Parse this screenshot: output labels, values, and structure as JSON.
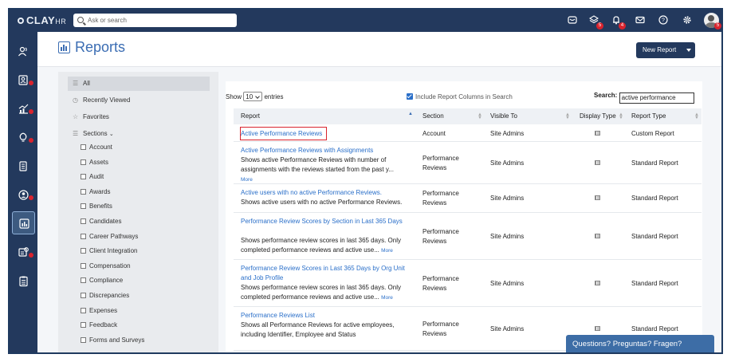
{
  "app": {
    "logo": "CLAY",
    "logo_suffix": "HR"
  },
  "search": {
    "placeholder": "Ask or search"
  },
  "topbar": {
    "badges": {
      "layers": "5",
      "bell": "4",
      "avatar": "5"
    }
  },
  "page": {
    "title": "Reports",
    "new_report_label": "New Report"
  },
  "sidebar": {
    "all": "All",
    "recently_viewed": "Recently Viewed",
    "favorites": "Favorites",
    "sections_label": "Sections",
    "sections": [
      "Account",
      "Assets",
      "Audit",
      "Awards",
      "Benefits",
      "Candidates",
      "Career Pathways",
      "Client Integration",
      "Compensation",
      "Compliance",
      "Discrepancies",
      "Expenses",
      "Feedback",
      "Forms and Surveys"
    ]
  },
  "table_controls": {
    "show_label": "Show",
    "entries_value": "10",
    "entries_label": "entries",
    "include_columns_label": "Include Report Columns in Search",
    "search_label": "Search:",
    "search_value": "active performance"
  },
  "table": {
    "headers": [
      "Report",
      "Section",
      "Visible To",
      "Display Type",
      "Report Type"
    ],
    "rows": [
      {
        "title": "Active Performance Reviews",
        "desc": "",
        "more": "",
        "section": "Account",
        "visible": "Site Admins",
        "type": "Custom Report"
      },
      {
        "title": "Active Performance Reviews with Assignments",
        "desc": "Shows active Performance Reviews with number of assignments with the reviews started from the past y...",
        "more": "More",
        "section": "Performance Reviews",
        "visible": "Site Admins",
        "type": "Standard Report"
      },
      {
        "title": "Active users with no active Performance Reviews.",
        "desc": "Shows active users with no active Performance Reviews.",
        "more": "",
        "section": "Performance Reviews",
        "visible": "Site Admins",
        "type": "Standard Report"
      },
      {
        "title": "Performance Review Scores by Section in Last 365 Days",
        "desc": "Shows performance review scores in last 365 days. Only completed performance reviews and active use...",
        "more": "More",
        "section": "Performance Reviews",
        "visible": "Site Admins",
        "type": "Standard Report"
      },
      {
        "title": "Performance Review Scores in Last 365 Days by Org Unit and Job Profile",
        "desc": "Shows performance review scores in last 365 days. Only completed performance reviews and active use...",
        "more": "More",
        "section": "Performance Reviews",
        "visible": "Site Admins",
        "type": "Standard Report"
      },
      {
        "title": "Performance Reviews List",
        "desc": "Shows all Performance Reviews for active employees, including Identifier, Employee and Status",
        "more": "",
        "section": "Performance Reviews",
        "visible": "Site Admins",
        "type": "Standard Report"
      }
    ]
  },
  "chat": {
    "label": "Questions? Preguntas? Fragen?"
  },
  "colors": {
    "nav": "#23395d",
    "accent": "#3b6db3",
    "highlight": "#d9232d"
  }
}
